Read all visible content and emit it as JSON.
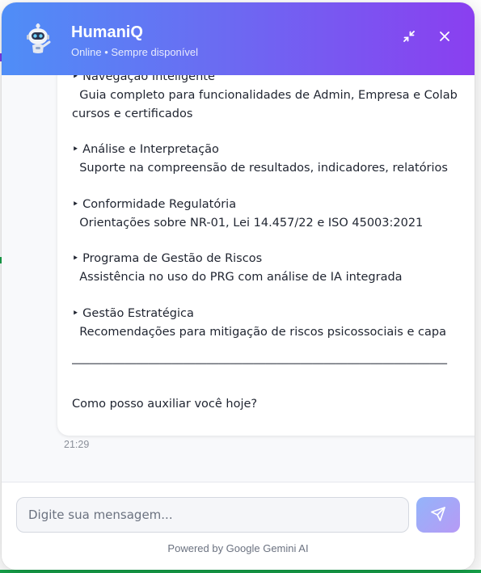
{
  "header": {
    "title": "HumaniQ",
    "status": "Online • Sempre disponível",
    "avatar_icon": "robot-icon",
    "minimize_icon": "minimize-icon",
    "close_icon": "close-icon",
    "gradient_start": "#4f8ef7",
    "gradient_end": "#8a3ff0"
  },
  "message": {
    "lines": [
      "‣ Navegação Inteligente",
      "  Guia completo para funcionalidades de Admin, Empresa e Colab",
      "cursos e certificados",
      "‣ Análise e Interpretação",
      "  Suporte na compreensão de resultados, indicadores, relatórios",
      "‣ Conformidade Regulatória",
      "  Orientações sobre NR-01, Lei 14.457/22 e ISO 45003:2021",
      "‣ Programa de Gestão de Riscos",
      "  Assistência no uso do PRG com análise de IA integrada",
      "‣ Gestão Estratégica",
      "  Recomendações para mitigação de riscos psicossociais e capa",
      "________________________________________________________________",
      "Como posso auxiliar você hoje?"
    ],
    "time": "21:29"
  },
  "input": {
    "placeholder": "Digite sua mensagem...",
    "value": "",
    "send_icon": "send-icon"
  },
  "footer": {
    "powered_by": "Powered by Google Gemini AI"
  }
}
